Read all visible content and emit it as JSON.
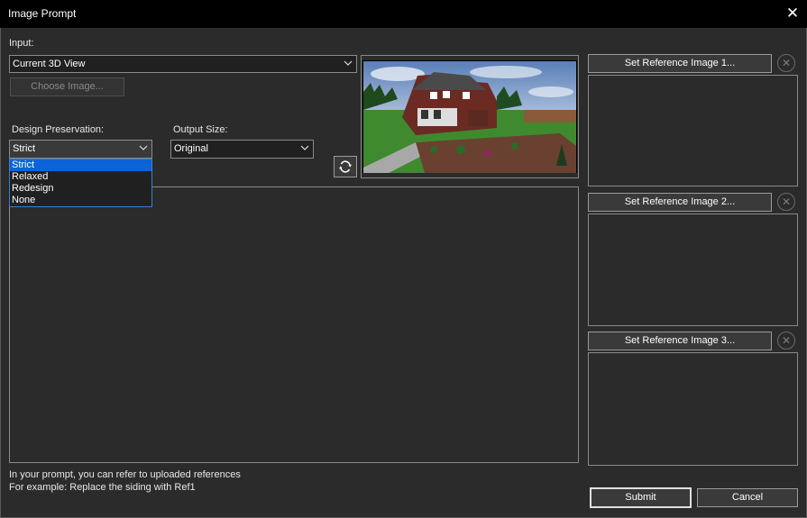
{
  "window": {
    "title": "Image Prompt",
    "close_icon": "close-icon"
  },
  "input": {
    "label": "Input:",
    "selected": "Current 3D View",
    "choose_image_label": "Choose Image..."
  },
  "design_preservation": {
    "label": "Design Preservation:",
    "selected": "Strict",
    "options": [
      "Strict",
      "Relaxed",
      "Redesign",
      "None"
    ]
  },
  "output_size": {
    "label": "Output Size:",
    "selected": "Original"
  },
  "references": [
    {
      "button_label": "Set Reference Image 1..."
    },
    {
      "button_label": "Set Reference Image 2..."
    },
    {
      "button_label": "Set Reference Image 3..."
    }
  ],
  "hint": {
    "line1": "In your prompt, you can refer to uploaded references",
    "line2": "For example: Replace the siding with Ref1"
  },
  "actions": {
    "submit": "Submit",
    "cancel": "Cancel"
  },
  "colors": {
    "background": "#2b2b2b",
    "titlebar": "#000000",
    "selection": "#0a64d8"
  }
}
